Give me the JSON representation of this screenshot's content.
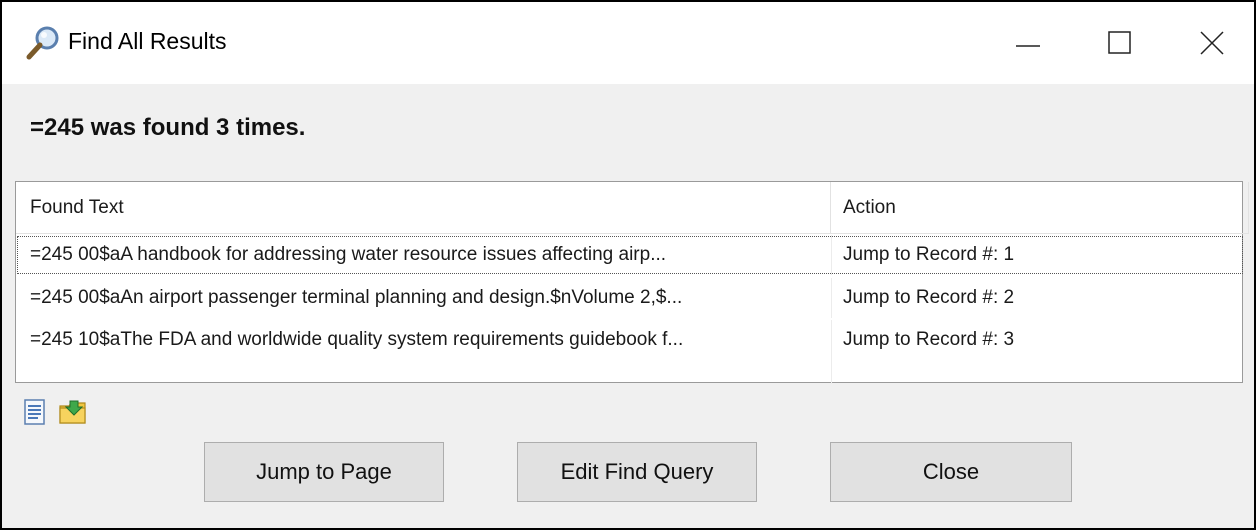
{
  "window": {
    "title": "Find All Results",
    "controls": {
      "minimize": "minimize",
      "maximize": "maximize",
      "close": "close"
    }
  },
  "message": "=245 was found 3 times.",
  "table": {
    "headers": {
      "found_text": "Found Text",
      "action": "Action"
    },
    "rows": [
      {
        "found_text": "=245  00$aA handbook for addressing water resource issues affecting airp...",
        "action": "Jump to Record #: 1"
      },
      {
        "found_text": "=245  00$aAn airport passenger terminal planning and design.$nVolume 2,$...",
        "action": "Jump to Record #: 2"
      },
      {
        "found_text": "=245  10$aThe FDA and worldwide quality system requirements guidebook f...",
        "action": "Jump to Record #: 3"
      }
    ]
  },
  "toolbar": {
    "icons": [
      "document-icon",
      "export-folder-icon"
    ]
  },
  "buttons": {
    "jump_to_page": "Jump to Page",
    "edit_find_query": "Edit Find Query",
    "close": "Close"
  }
}
